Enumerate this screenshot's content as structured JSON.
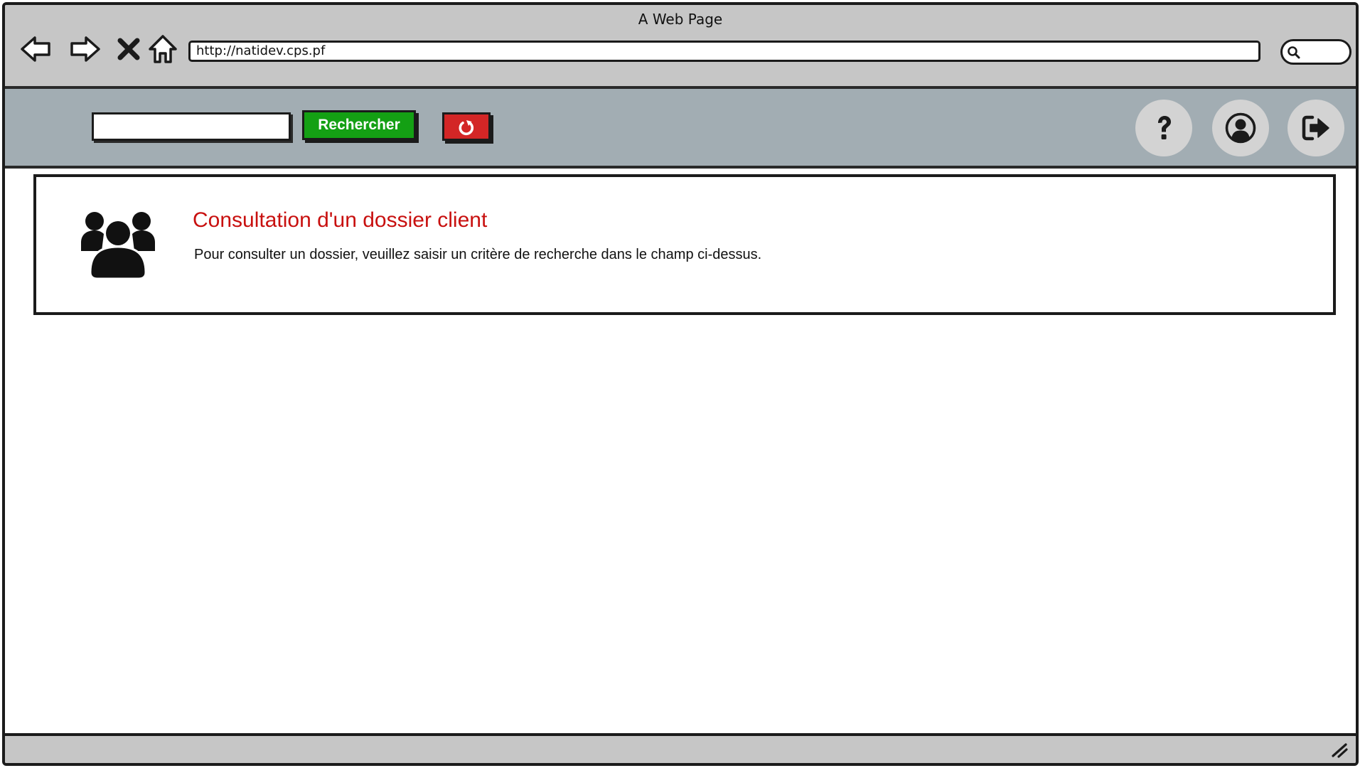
{
  "window": {
    "title": "A Web Page"
  },
  "browser": {
    "url": "http://natidev.cps.pf",
    "nav_icons": [
      "back-arrow-icon",
      "forward-arrow-icon",
      "stop-icon",
      "home-icon"
    ],
    "search_icon": "magnifier-icon"
  },
  "toolbar": {
    "search_value": "",
    "search_label": "Rechercher",
    "reset_icon": "refresh-icon",
    "help_icon": "question-mark-icon",
    "account_icon": "user-account-icon",
    "logout_icon": "sign-out-icon"
  },
  "panel": {
    "icon": "users-group-icon",
    "title": "Consultation d'un dossier client",
    "text": "Pour consulter un dossier, veuillez saisir un critère de recherche dans le champ ci-dessus."
  },
  "colors": {
    "chrome": "#c6c6c6",
    "toolbar": "#a2adb3",
    "search_button": "#14a014",
    "reset_button": "#d32626",
    "title_red": "#c8100f",
    "round_button": "#d3d3d3"
  }
}
